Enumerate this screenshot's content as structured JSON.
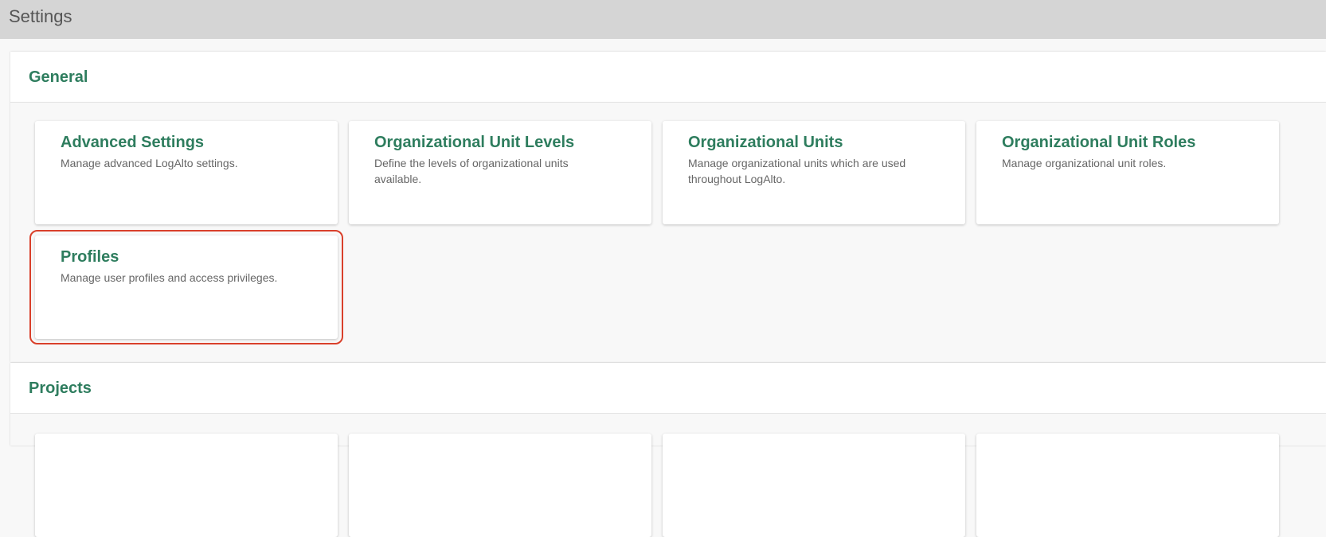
{
  "topbar": {
    "title": "Settings"
  },
  "sections": [
    {
      "title": "General",
      "cards": [
        {
          "title": "Advanced Settings",
          "description": "Manage advanced LogAlto settings."
        },
        {
          "title": "Organizational Unit Levels",
          "description": "Define the levels of organizational units available."
        },
        {
          "title": "Organizational Units",
          "description": "Manage organizational units which are used throughout LogAlto."
        },
        {
          "title": "Organizational Unit Roles",
          "description": "Manage organizational unit roles."
        },
        {
          "title": "Profiles",
          "description": "Manage user profiles and access privileges."
        }
      ]
    },
    {
      "title": "Projects"
    }
  ],
  "colors": {
    "accent": "#2e7d5e",
    "topbar": "#d5d5d5",
    "highlight": "#d9402b"
  }
}
